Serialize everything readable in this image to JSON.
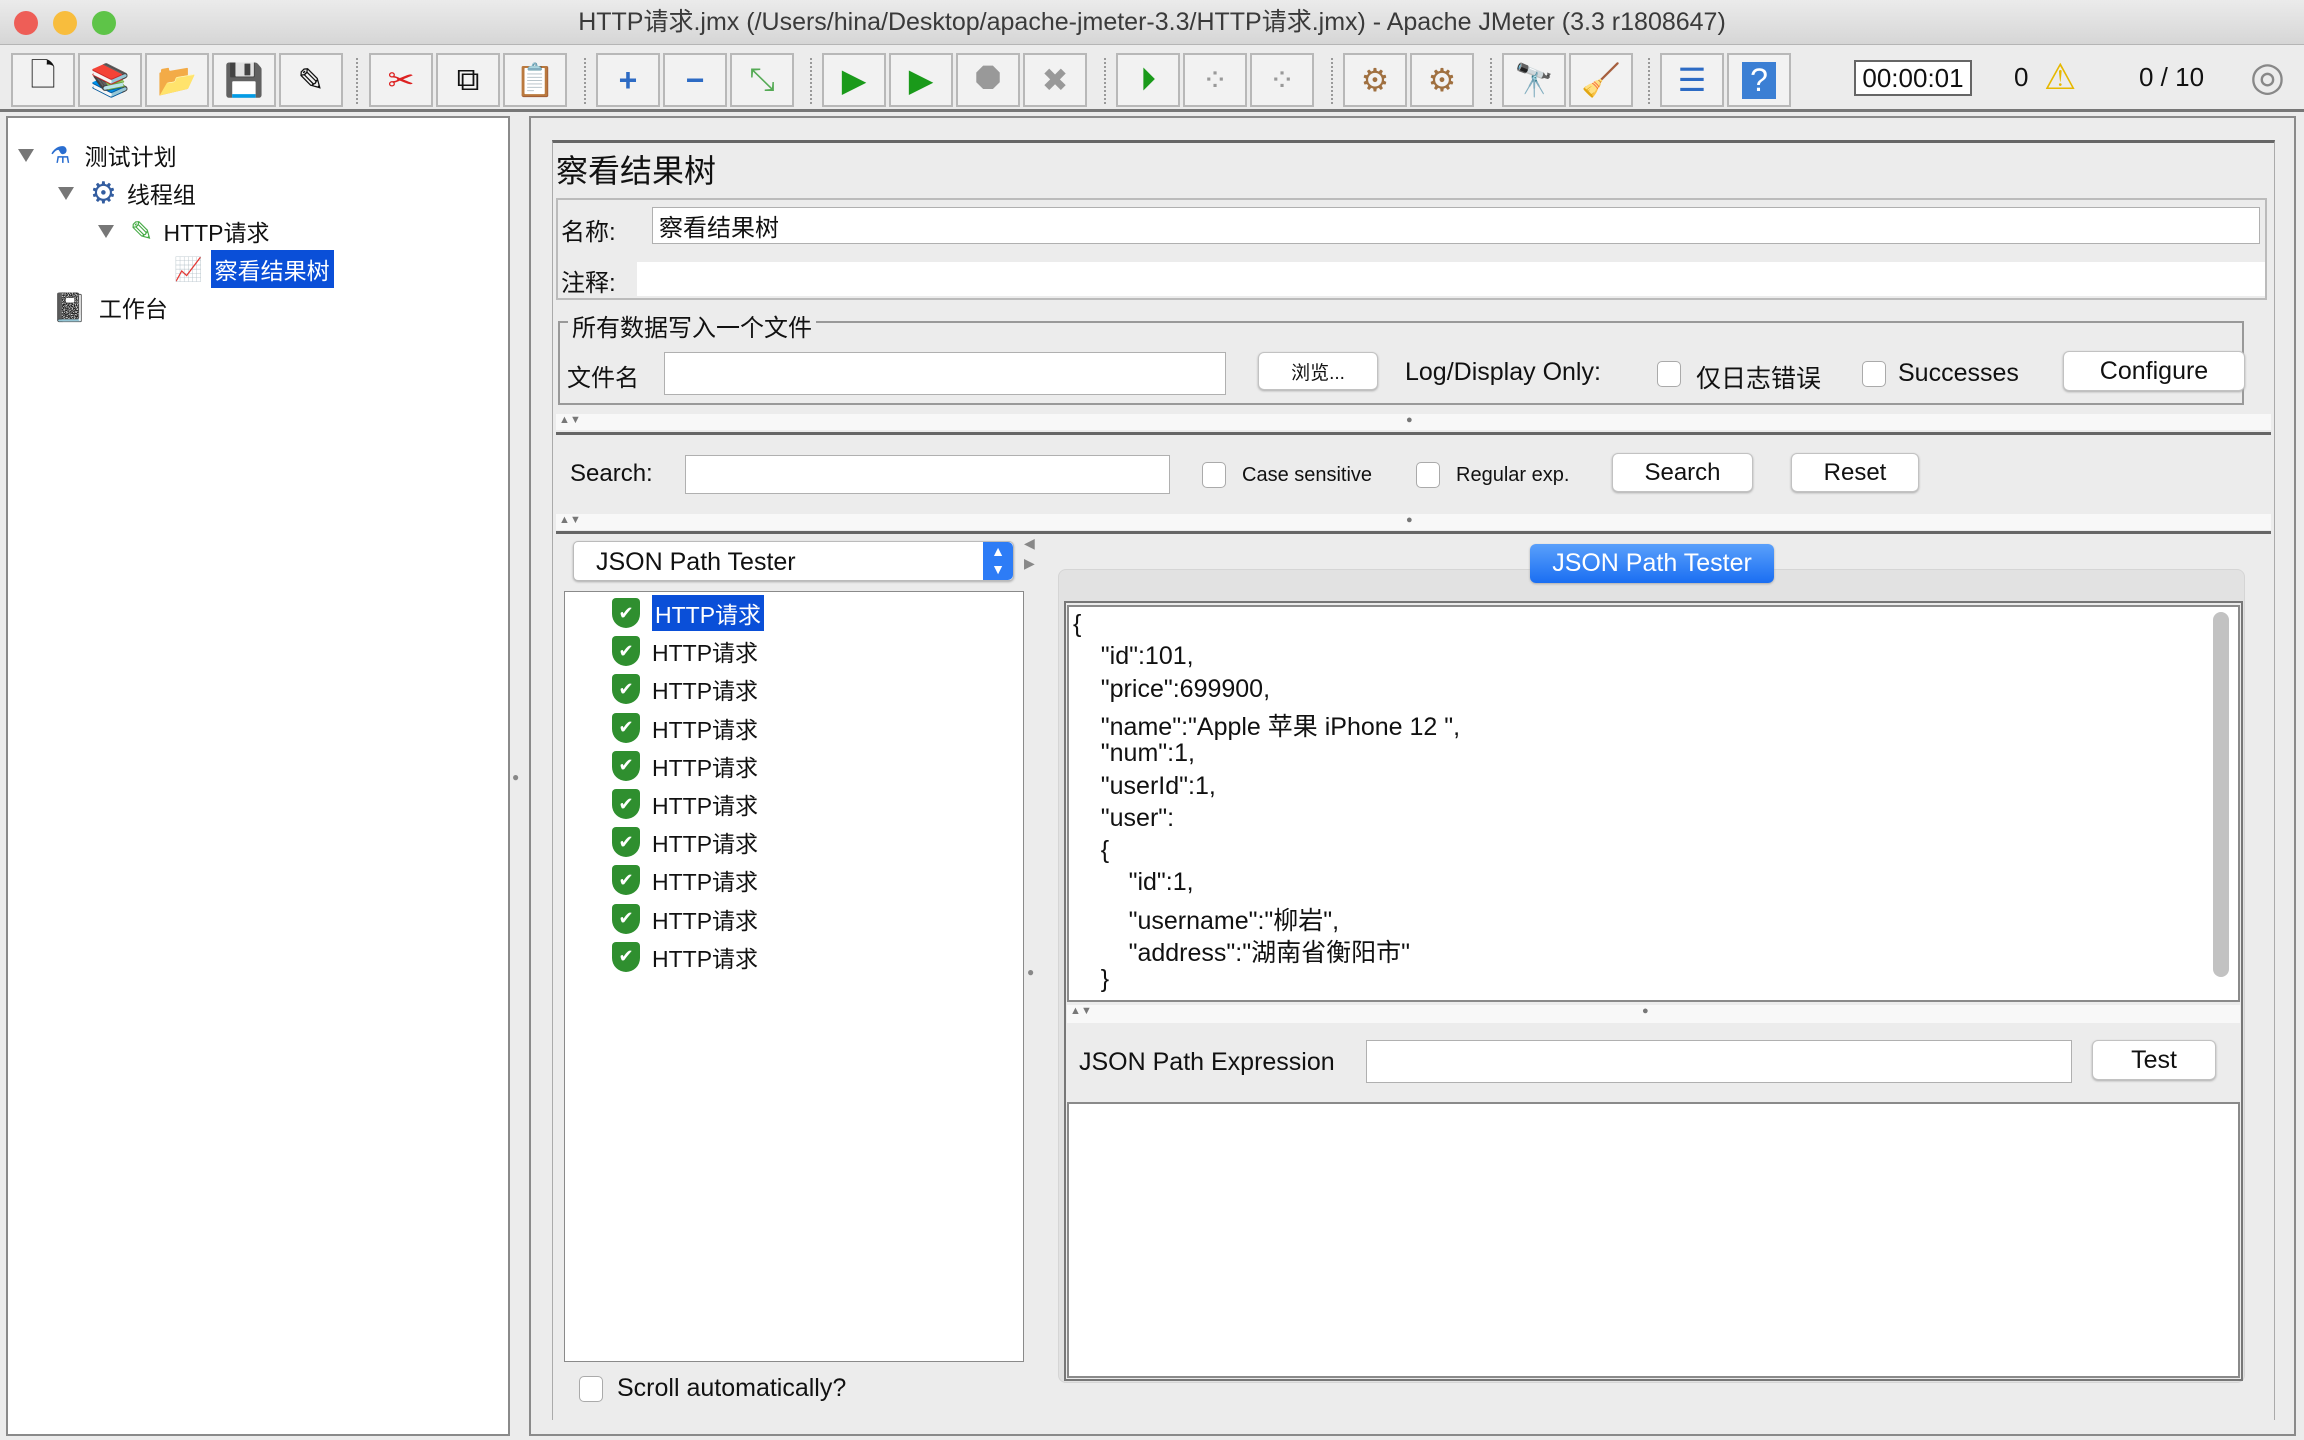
{
  "window": {
    "title": "HTTP请求.jmx (/Users/hina/Desktop/apache-jmeter-3.3/HTTP请求.jmx) - Apache JMeter (3.3 r1808647)"
  },
  "toolbar": {
    "icons": [
      "new-icon",
      "templates-icon",
      "open-icon",
      "save-icon",
      "save-as-icon",
      "cut-icon",
      "copy-icon",
      "paste-icon",
      "expand-icon",
      "collapse-icon",
      "toggle-icon",
      "start-icon",
      "start-no-pause-icon",
      "stop-icon",
      "shutdown-icon",
      "remote-start-icon",
      "remote-stop-icon",
      "remote-shutdown-icon",
      "clear-icon",
      "clear-all-icon",
      "search-icon",
      "reset-search-icon",
      "function-helper-icon",
      "help-icon"
    ],
    "timer": "00:00:01",
    "warnings": "0",
    "threads": "0 / 10"
  },
  "tree": {
    "items": [
      {
        "label": "测试计划",
        "icon": "test-plan-icon"
      },
      {
        "label": "线程组",
        "icon": "thread-group-icon"
      },
      {
        "label": "HTTP请求",
        "icon": "sampler-icon"
      },
      {
        "label": "察看结果树",
        "icon": "listener-icon",
        "selected": true
      },
      {
        "label": "工作台",
        "icon": "workbench-icon"
      }
    ]
  },
  "panel": {
    "title": "察看结果树",
    "name_label": "名称:",
    "name_value": "察看结果树",
    "comment_label": "注释:",
    "comment_value": "",
    "file_group": "所有数据写入一个文件",
    "filename_label": "文件名",
    "filename_value": "",
    "browse": "浏览...",
    "log_display": "Log/Display Only:",
    "errors_only": "仅日志错误",
    "successes": "Successes",
    "configure": "Configure"
  },
  "search": {
    "label": "Search:",
    "value": "",
    "case_sensitive": "Case sensitive",
    "regex": "Regular exp.",
    "search_button": "Search",
    "reset_button": "Reset"
  },
  "results": {
    "renderer": "JSON Path Tester",
    "samples": [
      "HTTP请求",
      "HTTP请求",
      "HTTP请求",
      "HTTP请求",
      "HTTP请求",
      "HTTP请求",
      "HTTP请求",
      "HTTP请求",
      "HTTP请求",
      "HTTP请求"
    ],
    "scroll_auto": "Scroll automatically?"
  },
  "tester": {
    "tab": "JSON Path Tester",
    "response_lines": [
      "{",
      "    \"id\":101,",
      "    \"price\":699900,",
      "    \"name\":\"Apple 苹果 iPhone 12 \",",
      "    \"num\":1,",
      "    \"userId\":1,",
      "    \"user\":",
      "    {",
      "        \"id\":1,",
      "        \"username\":\"柳岩\",",
      "        \"address\":\"湖南省衡阳市\"",
      "    }"
    ],
    "expression_label": "JSON Path Expression",
    "expression_value": "",
    "test_button": "Test",
    "result": ""
  },
  "colors": {
    "selection": "#0a4fd8",
    "tab": "#2d7cf6",
    "success": "#2f8f2f"
  }
}
